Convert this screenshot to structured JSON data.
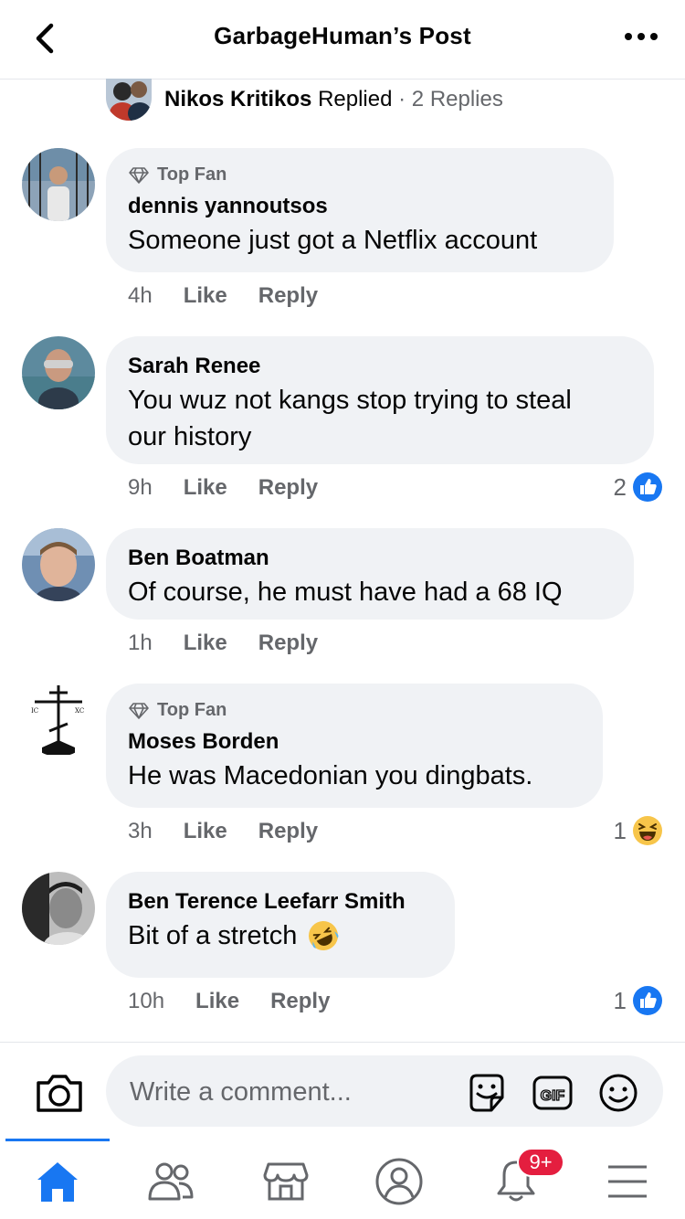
{
  "header": {
    "title": "GarbageHuman’s Post"
  },
  "replied": {
    "name": "Nikos Kritikos",
    "verb": "Replied",
    "separator": "·",
    "count": "2 Replies"
  },
  "comments": [
    {
      "badge": "Top Fan",
      "author": "dennis yannoutsos",
      "text": "Someone just got a Netflix account",
      "time": "4h",
      "like": "Like",
      "reply": "Reply",
      "reaction_count": "",
      "reaction": ""
    },
    {
      "badge": "",
      "author": "Sarah Renee",
      "text_line1": "You wuz not kangs stop trying to steal",
      "text_line2": "our history",
      "time": "9h",
      "like": "Like",
      "reply": "Reply",
      "reaction_count": "2",
      "reaction": "like-reaction-icon"
    },
    {
      "badge": "",
      "author": "Ben Boatman",
      "text": "Of course, he must have had a 68 IQ",
      "time": "1h",
      "like": "Like",
      "reply": "Reply",
      "reaction_count": "",
      "reaction": ""
    },
    {
      "badge": "Top Fan",
      "author": "Moses Borden",
      "text": "He was Macedonian you dingbats.",
      "time": "3h",
      "like": "Like",
      "reply": "Reply",
      "reaction_count": "1",
      "reaction": "haha-reaction-icon"
    },
    {
      "badge": "",
      "author": "Ben Terence Leefarr Smith",
      "text": "Bit of a stretch",
      "time": "10h",
      "like": "Like",
      "reply": "Reply",
      "reaction_count": "1",
      "reaction": "like-reaction-icon"
    }
  ],
  "composer": {
    "placeholder": "Write a comment..."
  },
  "nav": {
    "notifications_badge": "9+"
  },
  "colors": {
    "accent": "#1877f2",
    "bubble": "#f0f2f5",
    "secondary_text": "#65676b",
    "badge": "#e41e3f"
  }
}
